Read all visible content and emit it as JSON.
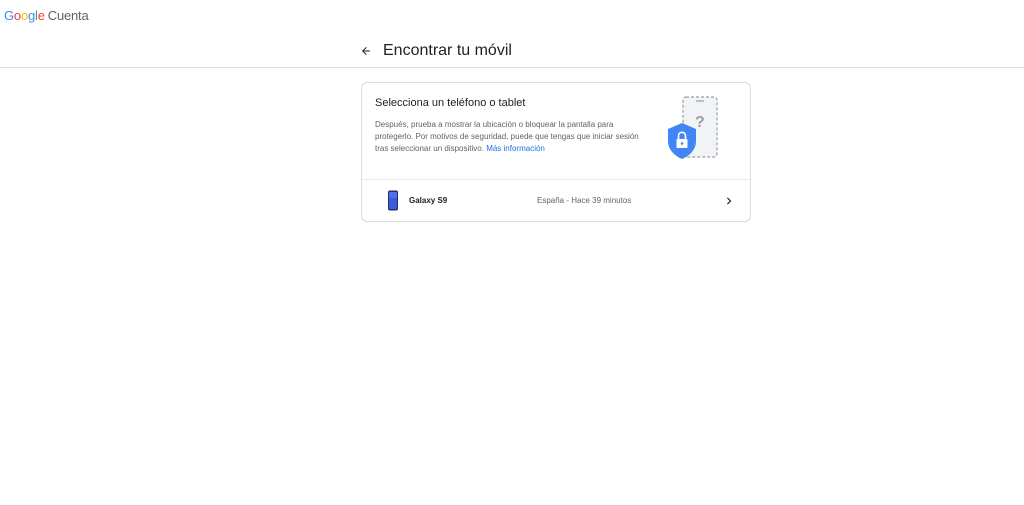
{
  "header": {
    "logo_text": "Google",
    "product_name": "Cuenta"
  },
  "page": {
    "back_icon": "arrow-back-icon",
    "title": "Encontrar tu móvil"
  },
  "card": {
    "heading": "Selecciona un teléfono o tablet",
    "description": "Después, prueba a mostrar la ubicación o bloquear la pantalla para protegerlo. Por motivos de seguridad, puede que tengas que iniciar sesión tras seleccionar un dispositivo.",
    "link_text": "Más información",
    "illustration_icon": "phone-shield-lock-icon",
    "colors": {
      "shield": "#4285f4",
      "link": "#1a73e8"
    }
  },
  "devices": [
    {
      "name": "Galaxy S9",
      "status": "España - Hace 39 minutos",
      "thumb_icon": "phone-thumbnail-icon",
      "chevron_icon": "chevron-right-icon"
    }
  ]
}
